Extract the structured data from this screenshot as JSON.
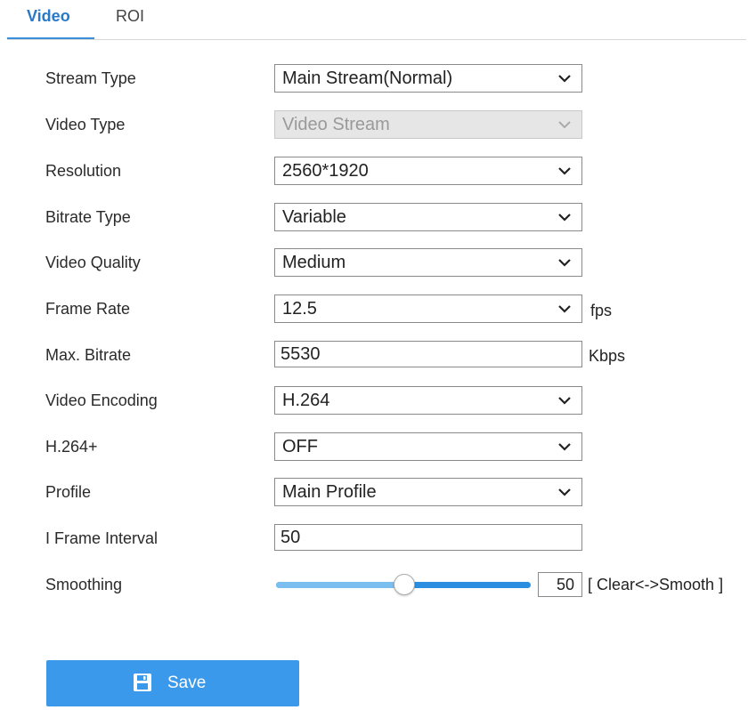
{
  "tabs": {
    "video": "Video",
    "roi": "ROI"
  },
  "fields": {
    "stream_type": {
      "label": "Stream Type",
      "value": "Main Stream(Normal)"
    },
    "video_type": {
      "label": "Video Type",
      "value": "Video Stream"
    },
    "resolution": {
      "label": "Resolution",
      "value": "2560*1920"
    },
    "bitrate_type": {
      "label": "Bitrate Type",
      "value": "Variable"
    },
    "video_quality": {
      "label": "Video Quality",
      "value": "Medium"
    },
    "frame_rate": {
      "label": "Frame Rate",
      "value": "12.5",
      "unit": "fps"
    },
    "max_bitrate": {
      "label": "Max. Bitrate",
      "value": "5530",
      "unit": "Kbps"
    },
    "video_encoding": {
      "label": "Video Encoding",
      "value": "H.264"
    },
    "h264_plus": {
      "label": "H.264+",
      "value": "OFF"
    },
    "profile": {
      "label": "Profile",
      "value": "Main Profile"
    },
    "i_frame_interval": {
      "label": "I Frame Interval",
      "value": "50"
    },
    "smoothing": {
      "label": "Smoothing",
      "value": "50",
      "hint": "[ Clear<->Smooth ]",
      "slider_fraction": 0.5
    }
  },
  "save": {
    "label": "Save"
  },
  "colors": {
    "accent": "#2979c9",
    "button": "#3a99ea"
  },
  "icons": {
    "dropdown": "chevron-down-icon",
    "save": "floppy-disk-icon"
  }
}
